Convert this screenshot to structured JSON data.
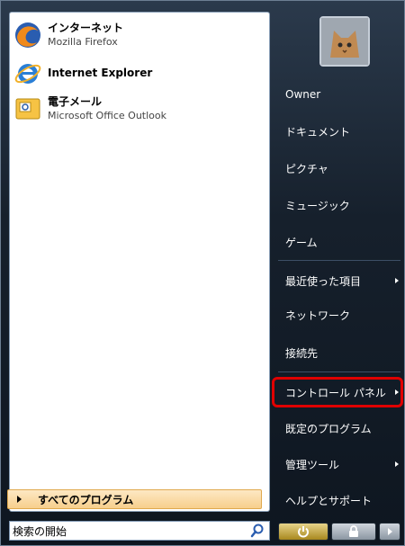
{
  "pinned_programs": [
    {
      "title": "インターネット",
      "subtitle": "Mozilla Firefox",
      "icon": "firefox-icon"
    },
    {
      "title": "Internet Explorer",
      "subtitle": "",
      "icon": "internet-explorer-icon"
    },
    {
      "title": "電子メール",
      "subtitle": "Microsoft Office Outlook",
      "icon": "outlook-icon"
    }
  ],
  "all_programs_label": "すべてのプログラム",
  "search": {
    "placeholder": "検索の開始"
  },
  "user": {
    "avatar_icon": "kitten-avatar"
  },
  "right_items": [
    {
      "label": "Owner",
      "submenu": false
    },
    {
      "label": "ドキュメント",
      "submenu": false
    },
    {
      "label": "ピクチャ",
      "submenu": false
    },
    {
      "label": "ミュージック",
      "submenu": false
    },
    {
      "label": "ゲーム",
      "submenu": false
    },
    {
      "label": "最近使った項目",
      "submenu": true
    },
    {
      "label": "ネットワーク",
      "submenu": false
    },
    {
      "label": "接続先",
      "submenu": false
    },
    {
      "label": "コントロール パネル",
      "submenu": true,
      "highlighted": true
    },
    {
      "label": "既定のプログラム",
      "submenu": false
    },
    {
      "label": "管理ツール",
      "submenu": true
    },
    {
      "label": "ヘルプとサポート",
      "submenu": false
    }
  ],
  "colors": {
    "highlight": "#e00000",
    "menu_dark": "#16202c",
    "all_programs_bg": "#f7cf8c"
  }
}
